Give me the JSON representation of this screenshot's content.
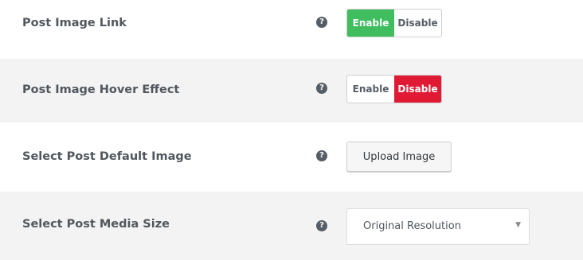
{
  "settings": [
    {
      "label": "Post Image Link",
      "help_icon": "question-circle-icon",
      "control": "toggle",
      "options": [
        "Enable",
        "Disable"
      ],
      "selected": "Enable",
      "active_color": "#3fbd5f"
    },
    {
      "label": "Post Image Hover Effect",
      "help_icon": "question-circle-icon",
      "control": "toggle",
      "options": [
        "Enable",
        "Disable"
      ],
      "selected": "Disable",
      "active_color": "#e01a34"
    },
    {
      "label": "Select Post Default Image",
      "help_icon": "question-circle-icon",
      "control": "button",
      "button_label": "Upload Image"
    },
    {
      "label": "Select Post Media Size",
      "help_icon": "question-circle-icon",
      "control": "select",
      "value": "Original Resolution",
      "arrow_icon": "caret-down-icon"
    }
  ],
  "help_glyph": "?",
  "select_arrow_glyph": "▼"
}
